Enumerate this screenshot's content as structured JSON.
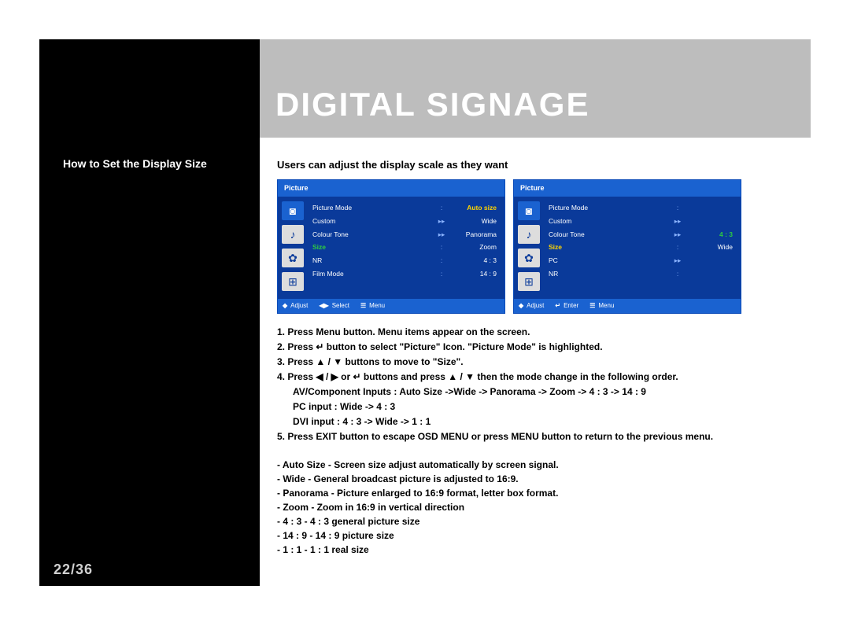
{
  "title": "DIGITAL SIGNAGE",
  "howto": "How to Set the Display  Size",
  "pagenum": "22/36",
  "intro": "Users can adjust the display scale as they want",
  "osd1": {
    "head": "Picture",
    "rows": [
      {
        "lbl": "Picture Mode",
        "sep": ":",
        "val": "Auto size",
        "hl": "yellow"
      },
      {
        "lbl": "Custom",
        "sep": "▸▸",
        "val": "Wide"
      },
      {
        "lbl": "Colour Tone",
        "sep": "▸▸",
        "val": "Panorama"
      },
      {
        "lbl": "Size",
        "sep": ":",
        "val": "Zoom",
        "lblhl": "green"
      },
      {
        "lbl": "NR",
        "sep": ":",
        "val": "4 : 3"
      },
      {
        "lbl": "Film Mode",
        "sep": ":",
        "val": "14 : 9"
      }
    ],
    "foot": [
      {
        "g": "◆",
        "t": "Adjust"
      },
      {
        "g": "◀▶",
        "t": "Select"
      },
      {
        "g": "☰",
        "t": "Menu"
      }
    ]
  },
  "osd2": {
    "head": "Picture",
    "rows": [
      {
        "lbl": "Picture Mode",
        "sep": ":",
        "val": ""
      },
      {
        "lbl": "Custom",
        "sep": "▸▸",
        "val": ""
      },
      {
        "lbl": "Colour Tone",
        "sep": "▸▸",
        "val": "4 : 3",
        "hl": "green"
      },
      {
        "lbl": "Size",
        "sep": ":",
        "val": "Wide",
        "lblhl": "yellow"
      },
      {
        "lbl": "PC",
        "sep": "▸▸",
        "val": ""
      },
      {
        "lbl": "NR",
        "sep": ":",
        "val": ""
      }
    ],
    "foot": [
      {
        "g": "◆",
        "t": "Adjust"
      },
      {
        "g": "↵",
        "t": "Enter"
      },
      {
        "g": "☰",
        "t": "Menu"
      }
    ]
  },
  "steps": {
    "s1": "1. Press Menu button. Menu items appear on the screen.",
    "s2a": "2. Press ",
    "s2b": " button to select \"Picture\" Icon. \"Picture Mode\"  is highlighted.",
    "s3a": "3. Press ",
    "s3b": " buttons to move to \"Size\".",
    "s4a": "4. Press ",
    "s4b": "  or ",
    "s4c": " buttons and press ",
    "s4d": " then the mode change in the following order.",
    "s4e": "AV/Component Inputs : Auto Size ->Wide -> Panorama -> Zoom -> 4 : 3 -> 14 : 9",
    "s4f": "PC input :  Wide -> 4 : 3",
    "s4g": "DVI input : 4 : 3 -> Wide -> 1 : 1",
    "s5": "5. Press EXIT button to escape OSD MENU or press MENU button to return to the previous menu."
  },
  "notes": {
    "n1": "- Auto Size - Screen size adjust automatically by screen signal.",
    "n2": "- Wide - General broadcast picture is adjusted to 16:9.",
    "n3": "- Panorama - Picture enlarged to 16:9 format, letter box format.",
    "n4": "- Zoom - Zoom in 16:9 in vertical direction",
    "n5": "- 4 : 3 - 4 : 3 general picture size",
    "n6": "- 14 : 9 - 14 : 9 picture size",
    "n7": "- 1 : 1 - 1 : 1 real size"
  },
  "glyph": {
    "updown": "▲ / ▼",
    "leftright": "◀ / ▶",
    "enter": "↵"
  }
}
